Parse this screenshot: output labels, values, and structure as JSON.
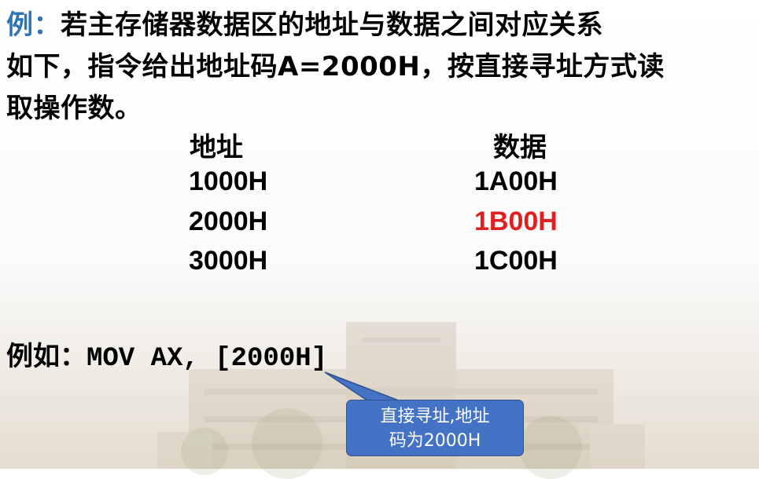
{
  "problem": {
    "prefix": "例：",
    "line1": "若主存储器数据区的地址与数据之间对应关系",
    "line2": "如下，指令给出地址码A=2000H，按直接寻址方式读",
    "line3": "取操作数。"
  },
  "table": {
    "headers": [
      "地址",
      "数据"
    ],
    "rows": [
      [
        "1000H",
        "1A00H"
      ],
      [
        "2000H",
        "1B00H"
      ],
      [
        "3000H",
        "1C00H"
      ]
    ],
    "highlight_color": "#e02020"
  },
  "example": {
    "label": "例如：",
    "code": "MOV AX, [2000H]"
  },
  "callout": {
    "line1": "直接寻址,地址",
    "line2": "码为2000H",
    "fill_color": "#4472c4"
  },
  "colors": {
    "prefix": "#2e75b6",
    "text": "#000000"
  }
}
